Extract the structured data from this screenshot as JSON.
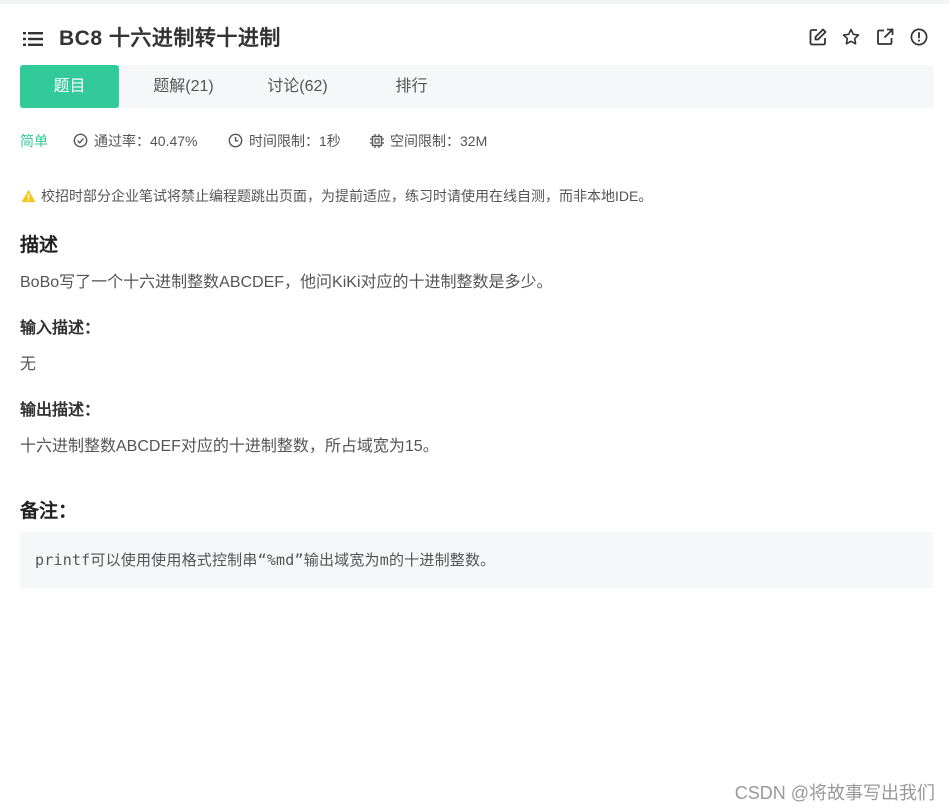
{
  "header": {
    "title": "BC8  十六进制转十进制",
    "icons": [
      "list-icon",
      "edit-icon",
      "star-icon",
      "external-link-icon",
      "info-icon"
    ]
  },
  "tabs": [
    {
      "label": "题目",
      "active": true
    },
    {
      "label": "题解(21)",
      "active": false
    },
    {
      "label": "讨论(62)",
      "active": false
    },
    {
      "label": "排行",
      "active": false
    }
  ],
  "meta": {
    "level": "简单",
    "pass_rate": "通过率：40.47%",
    "time_limit": "时间限制：1秒",
    "space_limit": "空间限制：32M"
  },
  "notice": "校招时部分企业笔试将禁止编程题跳出页面，为提前适应，练习时请使用在线自测，而非本地IDE。",
  "description": {
    "heading": "描述",
    "text": "BoBo写了一个十六进制整数ABCDEF，他问KiKi对应的十进制整数是多少。"
  },
  "input": {
    "heading": "输入描述：",
    "text": "无"
  },
  "output": {
    "heading": "输出描述：",
    "text": "十六进制整数ABCDEF对应的十进制整数，所占域宽为15。"
  },
  "remark": {
    "heading": "备注：",
    "code_text": "printf可以使用使用格式控制串“%md”输出域宽为m的十进制整数。"
  },
  "watermark": "CSDN @将故事写出我们",
  "colors": {
    "accent": "#32ca99",
    "warning": "#f5c518"
  }
}
